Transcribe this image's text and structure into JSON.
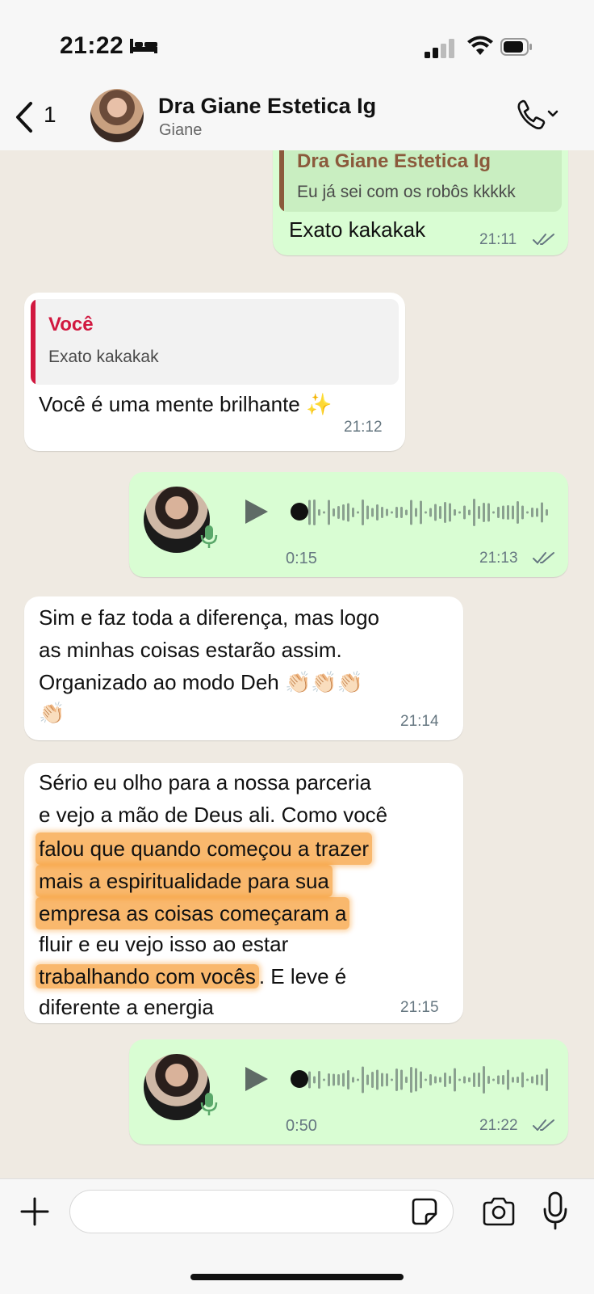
{
  "status_bar": {
    "time": "21:22"
  },
  "header": {
    "back_count": "1",
    "contact_name": "Dra Giane Estetica Ig",
    "contact_sub": "Giane"
  },
  "messages": {
    "m1": {
      "quote_name": "Dra Giane Estetica Ig",
      "quote_text": "Eu já sei com os robôs kkkkk",
      "text": "Exato kakakak",
      "time": "21:11"
    },
    "m2": {
      "quote_name": "Você",
      "quote_text": "Exato kakakak",
      "text": "Você é uma mente brilhante ✨",
      "time": "21:12"
    },
    "m3": {
      "duration": "0:15",
      "time": "21:13"
    },
    "m4": {
      "lines": [
        "Sim e faz toda a diferença, mas logo",
        "as minhas coisas estarão assim.",
        "Organizado ao modo Deh 👏🏻👏🏻👏🏻",
        "👏🏻"
      ],
      "time": "21:14"
    },
    "m5": {
      "line1": "Sério eu olho para a nossa parceria",
      "line2": "e vejo a mão de Deus ali. Como você",
      "line3": "falou que quando começou a trazer",
      "line4": "mais a espiritualidade para sua",
      "line5": "empresa as coisas começaram a",
      "line6": "fluir e eu vejo isso ao estar",
      "line7a": "trabalhando com vocês",
      "line7b": ". E leve é",
      "line8": "diferente a energia",
      "time": "21:15"
    },
    "m6": {
      "duration": "0:50",
      "time": "21:22"
    }
  },
  "colors": {
    "out_bubble": "#d9fdd3",
    "in_bubble": "#ffffff",
    "quote_out_name": "#8b5a3c",
    "quote_in_name": "#d1183f",
    "highlight": "#f6921e",
    "read_tick": "#667781"
  },
  "icons": [
    "bed-icon",
    "cellular-signal-icon",
    "wifi-icon",
    "battery-icon",
    "back-chevron-icon",
    "phone-icon",
    "chevron-down-icon",
    "play-icon",
    "microphone-icon",
    "plus-icon",
    "sticker-icon",
    "camera-icon"
  ]
}
